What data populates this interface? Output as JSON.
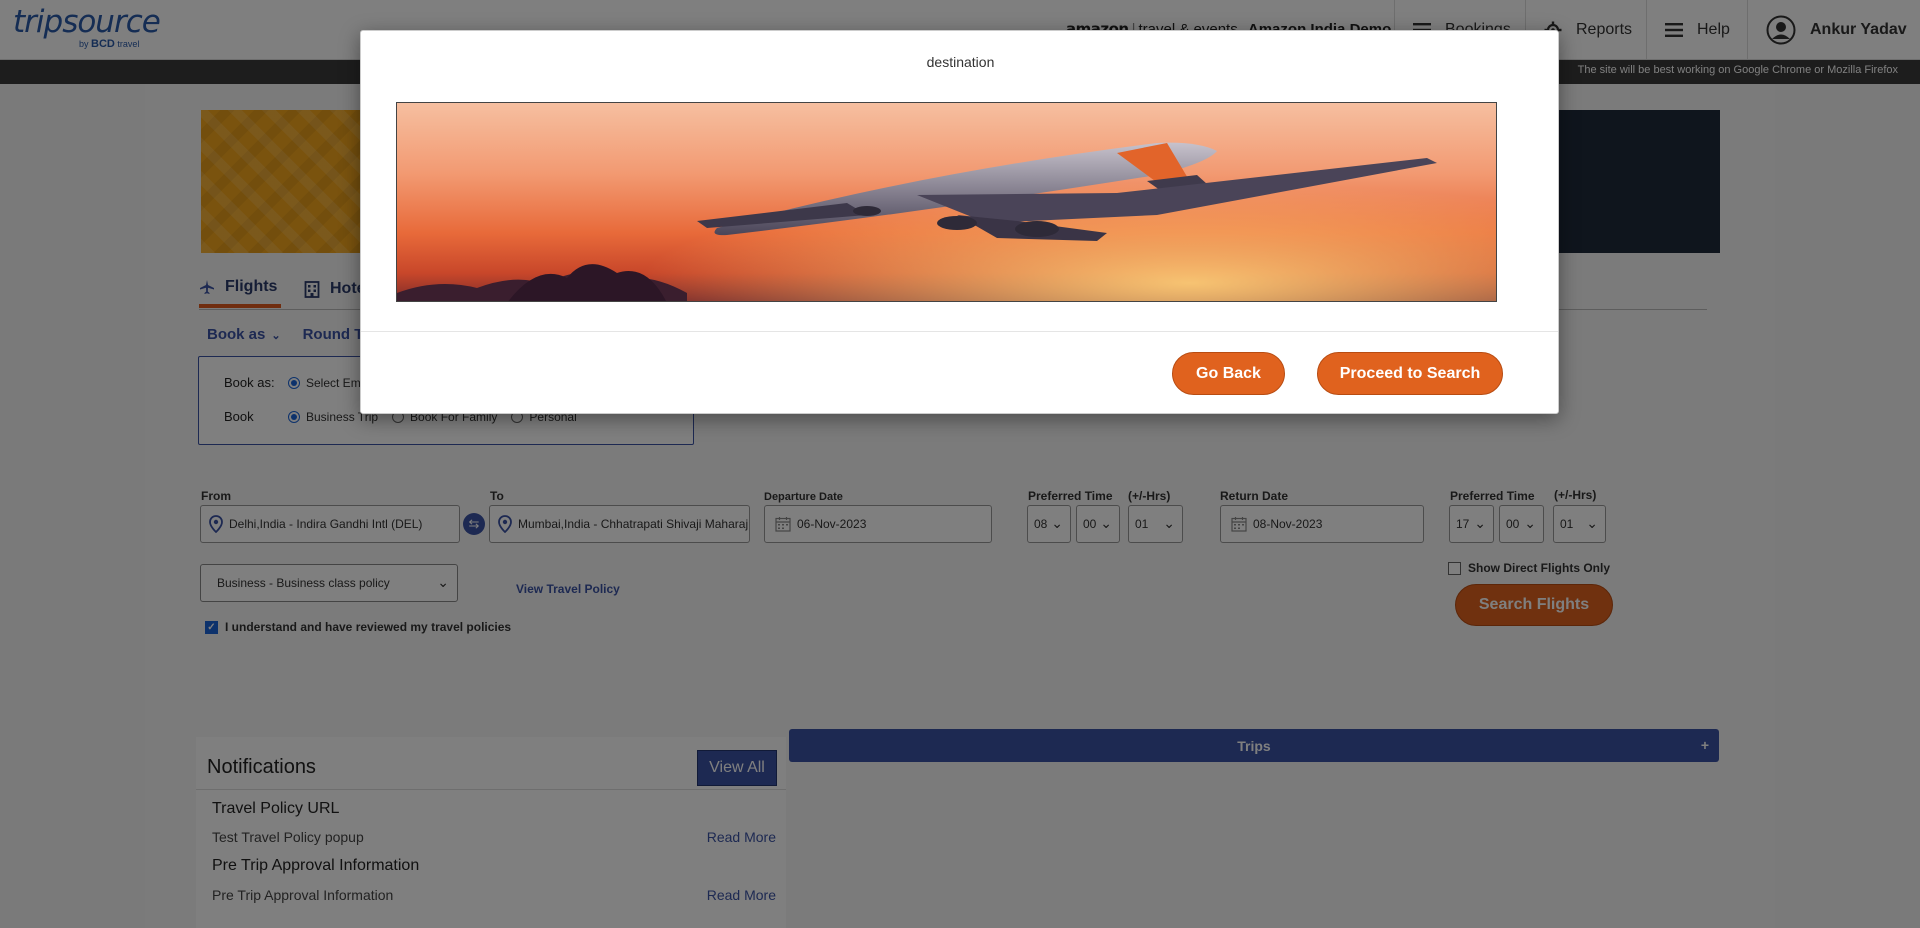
{
  "header": {
    "logo_main": "tripsource",
    "logo_by": "by",
    "logo_brand": "BCD",
    "logo_travel": "travel",
    "client_brand": "amazon",
    "client_sub": "travel & events",
    "client_org": "Amazon India Demo",
    "nav": {
      "bookings": "Bookings",
      "reports": "Reports",
      "help": "Help"
    },
    "user_name": "Ankur Yadav",
    "info_text": "The site will be best working on Google Chrome or Mozilla Firefox"
  },
  "tabs": {
    "flights": "Flights",
    "hotels": "Hotels"
  },
  "options": {
    "book_as": "Book as",
    "trip_type": "Round Trip"
  },
  "book_box": {
    "book_as_label": "Book as:",
    "book_as_option": "Select Employee",
    "book_label": "Book",
    "options": [
      "Business Trip",
      "Book For Family",
      "Personal"
    ]
  },
  "search": {
    "from_label": "From",
    "from_value": "Delhi,India - Indira Gandhi Intl (DEL)",
    "to_label": "To",
    "to_value": "Mumbai,India - Chhatrapati Shivaji Maharaj Intl (BOM)",
    "departure_label": "Departure Date",
    "departure_value": "06-Nov-2023",
    "pref_time_label": "Preferred Time",
    "hrs_label": "(+/-Hrs)",
    "dep_hour": "08",
    "dep_min": "00",
    "dep_hrs": "01",
    "return_label": "Return Date",
    "return_value": "08-Nov-2023",
    "ret_hour": "17",
    "ret_min": "00",
    "ret_hrs": "01",
    "policy_value": "Business - Business class policy",
    "view_policy": "View Travel Policy",
    "agree_text": "I understand and have reviewed my travel policies",
    "direct_only": "Show Direct Flights Only",
    "search_button": "Search Flights"
  },
  "notifications": {
    "title": "Notifications",
    "view_all": "View All",
    "items": [
      {
        "heading": "Travel Policy URL",
        "text": "Test Travel Policy popup",
        "more": "Read More"
      },
      {
        "heading": "Pre Trip Approval Information",
        "text": "Pre Trip Approval Information",
        "more": "Read More"
      }
    ]
  },
  "trips": {
    "title": "Trips",
    "toggle": "+"
  },
  "modal": {
    "title": "destination",
    "go_back": "Go Back",
    "proceed": "Proceed to Search"
  },
  "colors": {
    "brand_blue": "#3b53a4",
    "accent_orange": "#e0621e",
    "logo_blue": "#2b5aa8"
  }
}
